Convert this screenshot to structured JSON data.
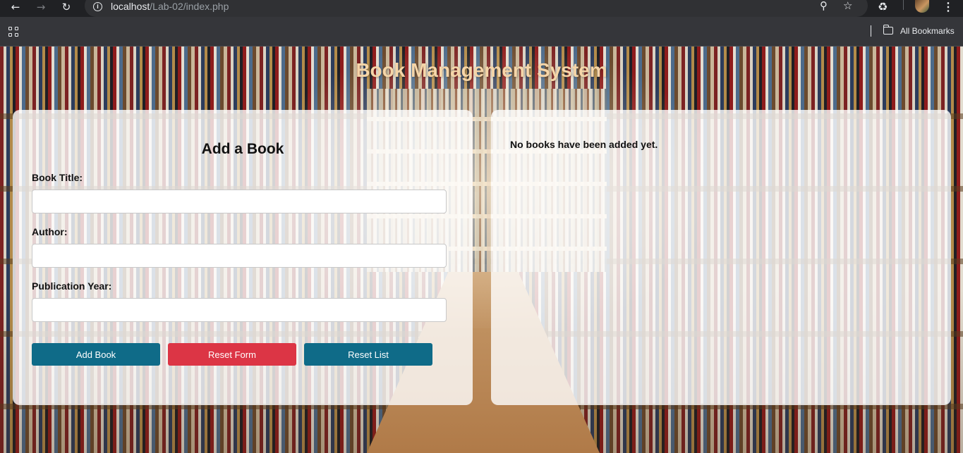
{
  "browser": {
    "url_host": "localhost",
    "url_path": "/Lab-02/index.php",
    "bookmarks_label": "All Bookmarks",
    "icons": [
      "back-arrow-icon",
      "forward-arrow-icon",
      "reload-icon",
      "site-info-icon",
      "zoom-icon",
      "star-icon",
      "extensions-icon",
      "avatar",
      "kebab-menu-icon",
      "apps-grid-icon",
      "folder-icon"
    ]
  },
  "page": {
    "title": "Book Management System",
    "title_color": "#f5d5a8"
  },
  "form": {
    "heading": "Add a Book",
    "fields": [
      {
        "label": "Book Title:",
        "value": "",
        "placeholder": ""
      },
      {
        "label": "Author:",
        "value": "",
        "placeholder": ""
      },
      {
        "label": "Publication Year:",
        "value": "",
        "placeholder": ""
      }
    ],
    "buttons": {
      "add": "Add Book",
      "reset_form": "Reset Form",
      "reset_list": "Reset List"
    },
    "colors": {
      "primary": "#0f6b88",
      "danger": "#dc3545"
    }
  },
  "list": {
    "empty_message": "No books have been added yet."
  }
}
